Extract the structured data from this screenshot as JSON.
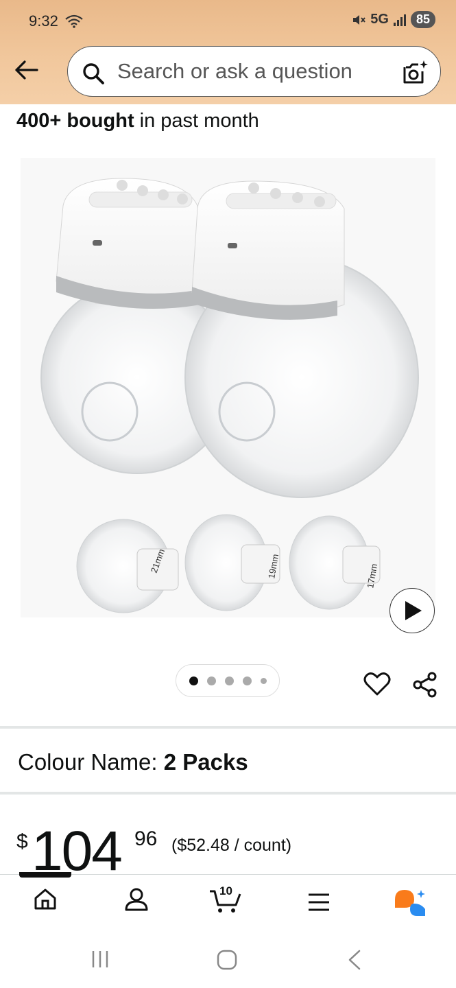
{
  "status_bar": {
    "time": "9:32",
    "network": "5G",
    "battery": "85"
  },
  "search": {
    "placeholder": "Search or ask a question"
  },
  "bought": {
    "count": "400+ bought",
    "suffix": "in past month"
  },
  "image_gallery": {
    "flange_sizes": [
      "21mm",
      "19mm",
      "17mm"
    ],
    "dots_total": 5,
    "active_index": 0
  },
  "colour": {
    "label": "Colour Name:",
    "value": "2 Packs"
  },
  "price": {
    "symbol": "$",
    "whole": "104",
    "fraction": "96",
    "unit_price": "($52.48 / count)"
  },
  "bottom_nav": {
    "cart_count": "10",
    "items": [
      "home-icon",
      "account-icon",
      "cart-icon",
      "menu-icon",
      "rufus-icon"
    ]
  },
  "colors": {
    "header": "#f1c79c",
    "accent_orange": "#f97b1b",
    "accent_blue": "#2a8cf0"
  }
}
